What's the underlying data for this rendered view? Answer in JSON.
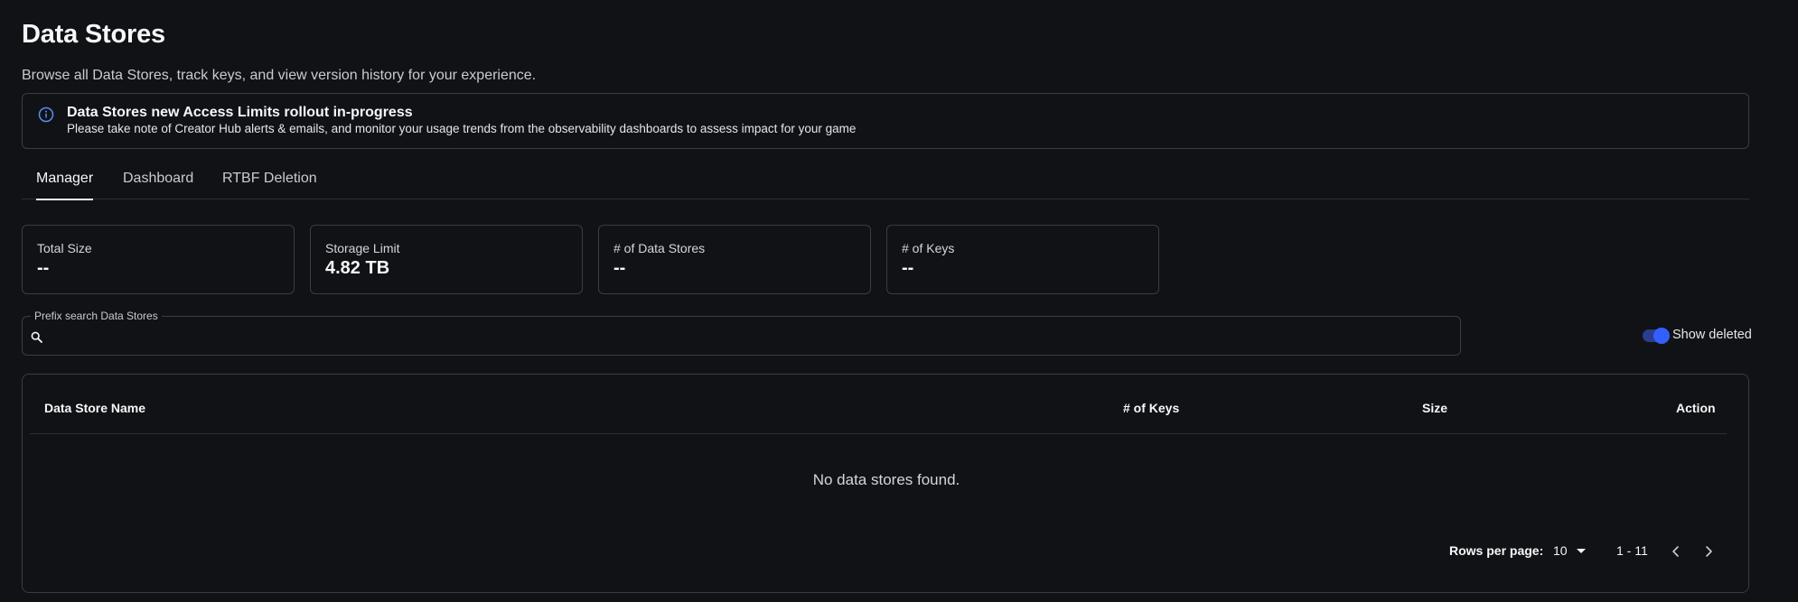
{
  "header": {
    "title": "Data Stores",
    "subtitle": "Browse all Data Stores, track keys, and view version history for your experience."
  },
  "banner": {
    "title": "Data Stores new Access Limits rollout in-progress",
    "body": "Please take note of Creator Hub alerts & emails, and monitor your usage trends from the observability dashboards to assess impact for your game",
    "icon": "info-icon",
    "accent": "#5b8def"
  },
  "tabs": [
    {
      "label": "Manager",
      "active": true
    },
    {
      "label": "Dashboard",
      "active": false
    },
    {
      "label": "RTBF Deletion",
      "active": false
    }
  ],
  "stats": [
    {
      "label": "Total Size",
      "value": "--"
    },
    {
      "label": "Storage Limit",
      "value": "4.82 TB"
    },
    {
      "label": "# of Data Stores",
      "value": "--"
    },
    {
      "label": "# of Keys",
      "value": "--"
    }
  ],
  "search": {
    "legend": "Prefix search Data Stores",
    "value": "",
    "icon": "search-icon"
  },
  "toggle": {
    "label": "Show deleted",
    "on": true,
    "color": "#335fff"
  },
  "table": {
    "columns": [
      "Data Store Name",
      "# of Keys",
      "Size",
      "Action"
    ],
    "rows": [],
    "empty_message": "No data stores found."
  },
  "pagination": {
    "rows_label": "Rows per page:",
    "rows_per_page": "10",
    "range": "1 - 11"
  }
}
